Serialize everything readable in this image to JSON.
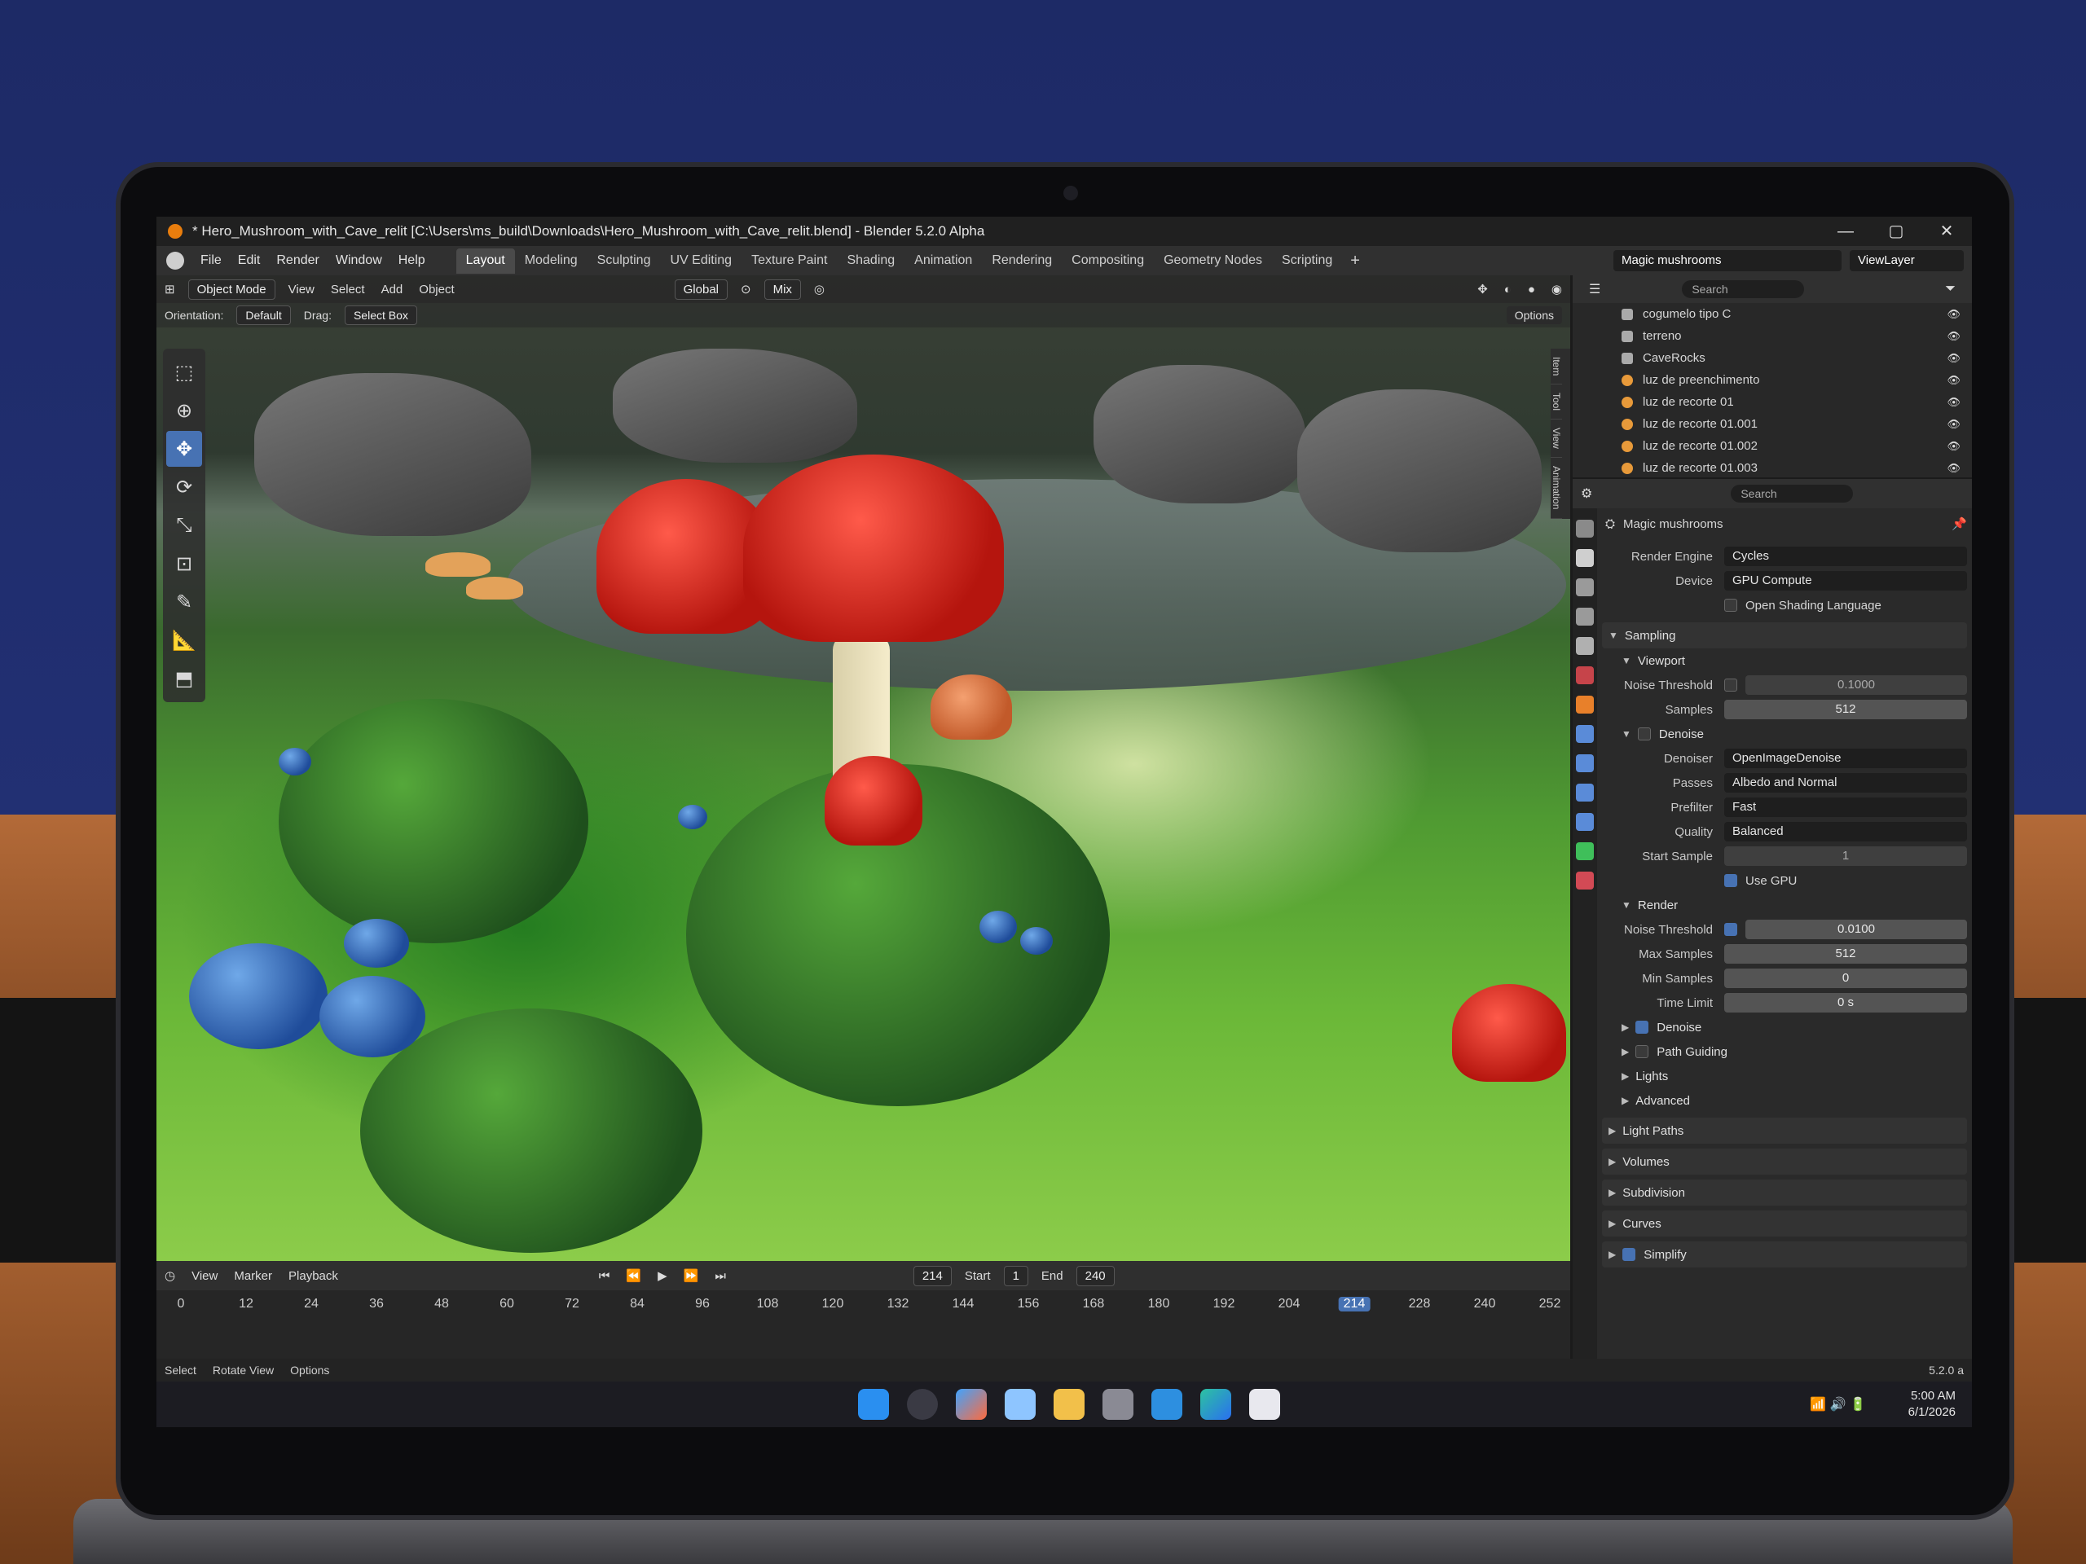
{
  "window": {
    "title": "* Hero_Mushroom_with_Cave_relit [C:\\Users\\ms_build\\Downloads\\Hero_Mushroom_with_Cave_relit.blend] - Blender 5.2.0 Alpha",
    "controls": [
      "—",
      "▢",
      "✕"
    ]
  },
  "menu": [
    "File",
    "Edit",
    "Render",
    "Window",
    "Help"
  ],
  "workspaces": [
    "Layout",
    "Modeling",
    "Sculpting",
    "UV Editing",
    "Texture Paint",
    "Shading",
    "Animation",
    "Rendering",
    "Compositing",
    "Geometry Nodes",
    "Scripting"
  ],
  "active_workspace": "Layout",
  "scene_name": "Magic mushrooms",
  "view_layer": "ViewLayer",
  "viewport": {
    "mode": "Object Mode",
    "header_menus": [
      "View",
      "Select",
      "Add",
      "Object"
    ],
    "transform_orientation": "Global",
    "shading_mix": "Mix",
    "orientation_label": "Orientation:",
    "orientation_value": "Default",
    "drag_label": "Drag:",
    "drag_value": "Select Box",
    "options": "Options",
    "side_tabs": [
      "Item",
      "Tool",
      "View",
      "Animation"
    ],
    "tools": [
      "select-box-icon",
      "cursor-icon",
      "move-icon",
      "rotate-icon",
      "scale-icon",
      "transform-icon",
      "annotate-icon",
      "measure-icon",
      "add-cube-icon"
    ]
  },
  "timeline": {
    "menus": [
      "View",
      "Marker",
      "Playback"
    ],
    "current_frame": "214",
    "start_label": "Start",
    "start": "1",
    "end_label": "End",
    "end": "240",
    "frames": [
      "0",
      "12",
      "24",
      "36",
      "48",
      "60",
      "72",
      "84",
      "96",
      "108",
      "120",
      "132",
      "144",
      "156",
      "168",
      "180",
      "192",
      "204",
      "214",
      "228",
      "240",
      "252"
    ]
  },
  "statusbar": {
    "items": [
      "Select",
      "Rotate View",
      "Options"
    ],
    "version": "5.2.0 a"
  },
  "outliner": {
    "search_placeholder": "Search",
    "items": [
      {
        "name": "cogumelo tipo C",
        "kind": "collection"
      },
      {
        "name": "terreno",
        "kind": "collection"
      },
      {
        "name": "CaveRocks",
        "kind": "collection"
      },
      {
        "name": "luz de preenchimento",
        "kind": "light"
      },
      {
        "name": "luz de recorte 01",
        "kind": "light"
      },
      {
        "name": "luz de recorte 01.001",
        "kind": "light"
      },
      {
        "name": "luz de recorte 01.002",
        "kind": "light"
      },
      {
        "name": "luz de recorte 01.003",
        "kind": "light"
      }
    ]
  },
  "properties": {
    "search_placeholder": "Search",
    "scene": "Magic mushrooms",
    "render_engine_label": "Render Engine",
    "render_engine": "Cycles",
    "device_label": "Device",
    "device": "GPU Compute",
    "osl_label": "Open Shading Language",
    "sampling": {
      "title": "Sampling",
      "viewport": {
        "title": "Viewport",
        "noise_threshold_label": "Noise Threshold",
        "noise_threshold": "0.1000",
        "samples_label": "Samples",
        "samples": "512"
      },
      "denoise": {
        "title": "Denoise",
        "denoiser_label": "Denoiser",
        "denoiser": "OpenImageDenoise",
        "passes_label": "Passes",
        "passes": "Albedo and Normal",
        "prefilter_label": "Prefilter",
        "prefilter": "Fast",
        "quality_label": "Quality",
        "quality": "Balanced",
        "start_sample_label": "Start Sample",
        "start_sample": "1",
        "use_gpu_label": "Use GPU"
      },
      "render": {
        "title": "Render",
        "noise_threshold_label": "Noise Threshold",
        "noise_threshold": "0.0100",
        "max_samples_label": "Max Samples",
        "max_samples": "512",
        "min_samples_label": "Min Samples",
        "min_samples": "0",
        "time_limit_label": "Time Limit",
        "time_limit": "0 s"
      },
      "subpanels": [
        "Denoise",
        "Path Guiding",
        "Lights",
        "Advanced"
      ]
    },
    "panels": [
      "Light Paths",
      "Volumes",
      "Subdivision",
      "Curves",
      "Simplify"
    ]
  },
  "taskbar": {
    "time": "5:00 AM",
    "date": "6/1/2026"
  },
  "colors": {
    "accent": "#4772b3",
    "blender_orange": "#e87d0d"
  }
}
